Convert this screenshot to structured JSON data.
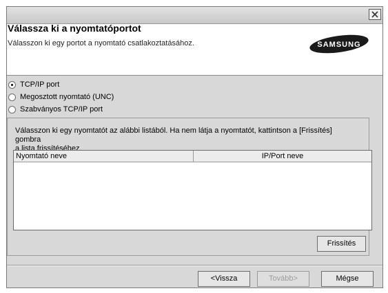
{
  "dialog": {
    "title": "Válassza ki a nyomtatóportot",
    "subtitle": "Válasszon ki egy portot a nyomtató csatlakoztatásához.",
    "brand": "SAMSUNG"
  },
  "port_options": [
    {
      "label": "TCP/IP port",
      "selected": true
    },
    {
      "label": "Megosztott nyomtató (UNC)",
      "selected": false
    },
    {
      "label": "Szabványos TCP/IP port",
      "selected": false
    }
  ],
  "printer_list": {
    "instruction_line1": "Válasszon ki egy nyomtatót az alábbi listából. Ha nem látja a nyomtatót, kattintson a [Frissítés] gombra",
    "instruction_line2": "a lista frissítéséhez.",
    "columns": [
      "Nyomtató neve",
      "IP/Port neve"
    ],
    "rows": []
  },
  "buttons": {
    "refresh": "Frissítés",
    "back": "<Vissza",
    "next": "Tovább>",
    "cancel": "Mégse"
  }
}
